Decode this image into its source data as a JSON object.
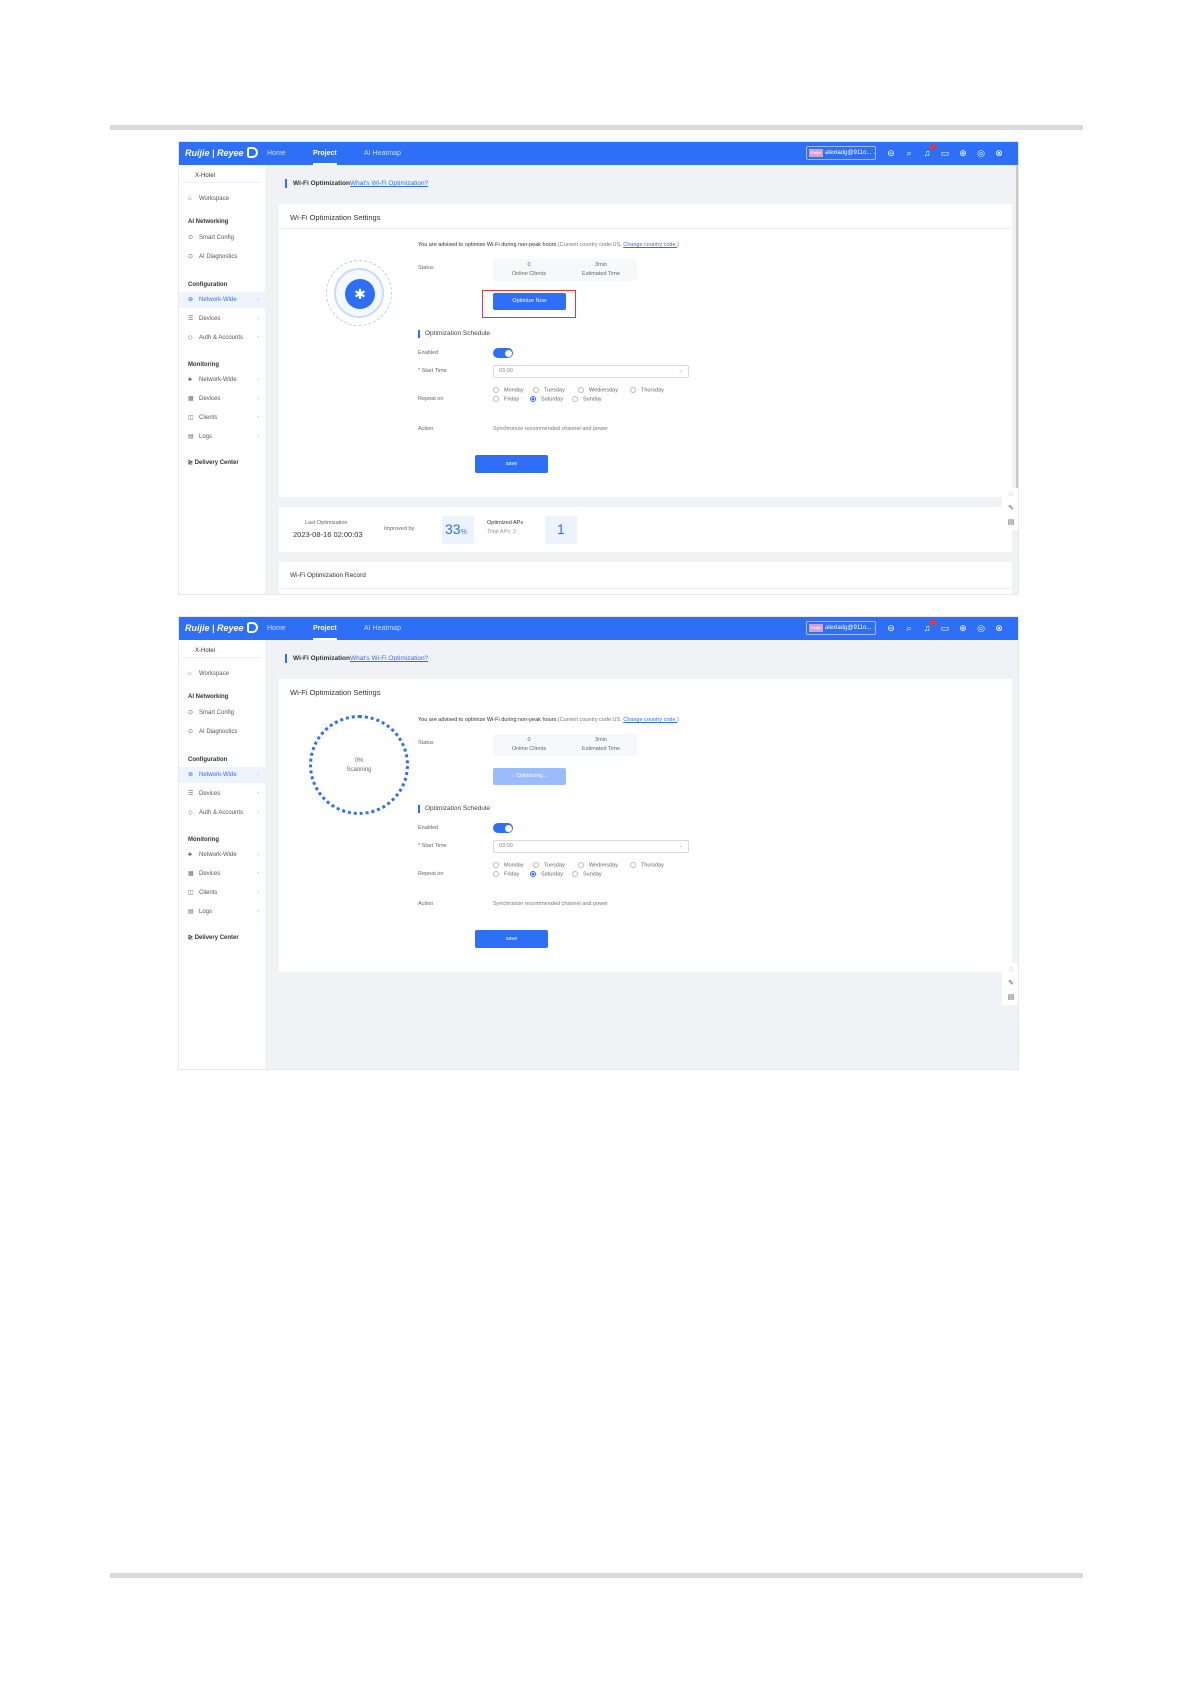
{
  "app": {
    "brand": "Ruijie | Reyee",
    "nav": [
      "Home",
      "Project",
      "AI Heatmap"
    ],
    "account": "alexladg@911o...",
    "account_badge": "Ruijie"
  },
  "sidebar": {
    "project": "X-Hotel",
    "items": {
      "workspace": "Workspace",
      "ai_networking": "AI Networking",
      "smart_config": "Smart Config",
      "ai_diagnostics": "AI Diagnostics",
      "configuration": "Configuration",
      "network_wide": "Network-Wide",
      "devices": "Devices",
      "auth_accounts": "Auth & Accounts",
      "monitoring": "Monitoring",
      "mon_network_wide": "Network-Wide",
      "mon_devices": "Devices",
      "clients": "Clients",
      "logs": "Logs",
      "delivery_center": "Delivery Center"
    }
  },
  "breadcrumb": {
    "title": "Wi-Fi Optimization",
    "link": "What's Wi-Fi Optimization?"
  },
  "settings": {
    "title": "Wi-Fi Optimization Settings",
    "advice": "You are advised to optimize Wi-Fi during non-peak hours.",
    "country_note": "(Current country code:US,",
    "change_link": "Change country code.",
    "close_paren": ")",
    "status_label": "Status",
    "online_clients_value": "0",
    "online_clients_label": "Online Clients",
    "estimated_value": "3min",
    "estimated_label": "Estimated Time",
    "optimize_now": "Optimize Now",
    "optimizing": "Optimizing...",
    "scan_percent": "0%",
    "scan_status": "Scanning",
    "schedule_title": "Optimization Schedule",
    "enabled_label": "Enabled",
    "start_time_label": "* Start Time",
    "start_time_value": "03:00",
    "repeat_label": "Repeat on",
    "days": {
      "monday": "Monday",
      "tuesday": "Tuesday",
      "wednesday": "Wednesday",
      "thursday": "Thursday",
      "friday": "Friday",
      "saturday": "Saturday",
      "sunday": "Sunday"
    },
    "action_label": "Action",
    "action_value": "Synchronize recommended channel and power",
    "save": "save"
  },
  "summary": {
    "last_label": "Last Optimization",
    "last_value": "2023-08-16 02:00:03",
    "improved_label": "Improved by",
    "improved_value": "33",
    "improved_unit": "%",
    "optimized_label": "Optimized APs",
    "total_aps": "Total APs: 2",
    "optimized_value": "1"
  },
  "record_title": "Wi-Fi Optimization Record",
  "colors": {
    "primary": "#2f6ff6",
    "highlight": "#e53935"
  }
}
